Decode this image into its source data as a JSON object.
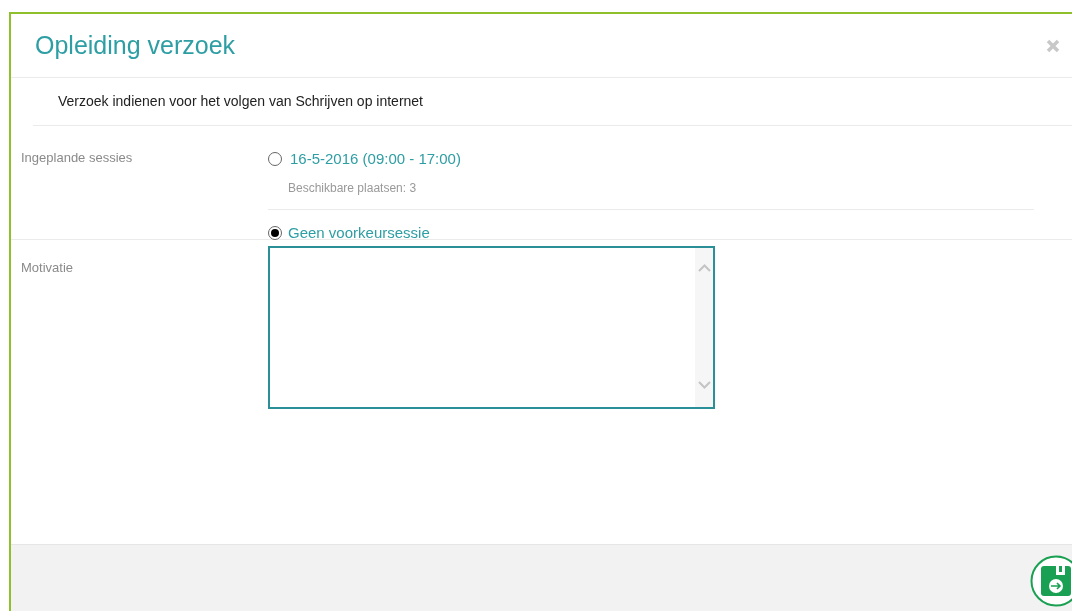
{
  "dialog": {
    "title": "Opleiding verzoek"
  },
  "intro": "Verzoek indienen voor het volgen van Schrijven op internet",
  "sessions": {
    "label": "Ingeplande sessies",
    "options": [
      {
        "label": "16-5-2016 (09:00 - 17:00)",
        "note": "Beschikbare plaatsen: 3",
        "selected": false
      },
      {
        "label": "Geen voorkeursessie",
        "selected": true
      }
    ]
  },
  "motivation": {
    "label": "Motivatie"
  }
}
